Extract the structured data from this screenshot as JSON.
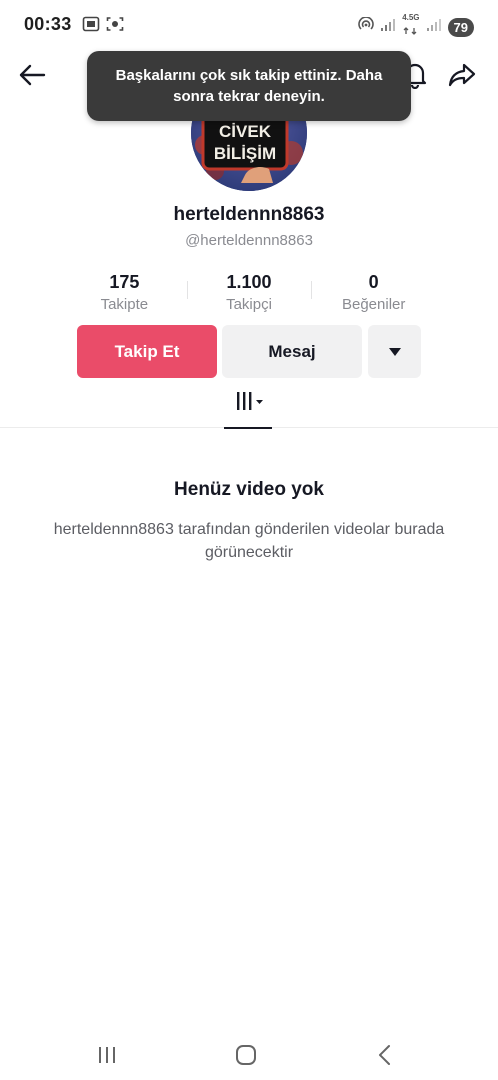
{
  "status_bar": {
    "time": "00:33",
    "network_label_top": "4.5G",
    "battery": "79"
  },
  "toast": {
    "message": "Başkalarını çok sık takip ettiniz. Daha sonra tekrar deneyin."
  },
  "avatar": {
    "sign_line1": "CİVEK",
    "sign_line2": "BİLİŞİM"
  },
  "profile": {
    "display_name": "herteldennn8863",
    "handle": "@herteldennn8863"
  },
  "stats": [
    {
      "value": "175",
      "label": "Takipte"
    },
    {
      "value": "1.100",
      "label": "Takipçi"
    },
    {
      "value": "0",
      "label": "Beğeniler"
    }
  ],
  "actions": {
    "follow_label": "Takip Et",
    "message_label": "Mesaj"
  },
  "empty_state": {
    "title": "Henüz video yok",
    "description": "herteldennn8863 tarafından gönderilen videolar burada görünecektir"
  },
  "colors": {
    "follow_button": "#ea4c69",
    "secondary_button": "#f1f1f2",
    "toast_background": "#3a3a3a"
  },
  "icons": {
    "back": "arrow-left-icon",
    "bell": "bell-icon",
    "share": "share-arrow-icon",
    "more": "triangle-down-icon",
    "videos_tab": "grid-bars-icon",
    "recent_apps": "recent-apps-icon",
    "home": "home-icon",
    "system_back": "chevron-left-icon"
  }
}
